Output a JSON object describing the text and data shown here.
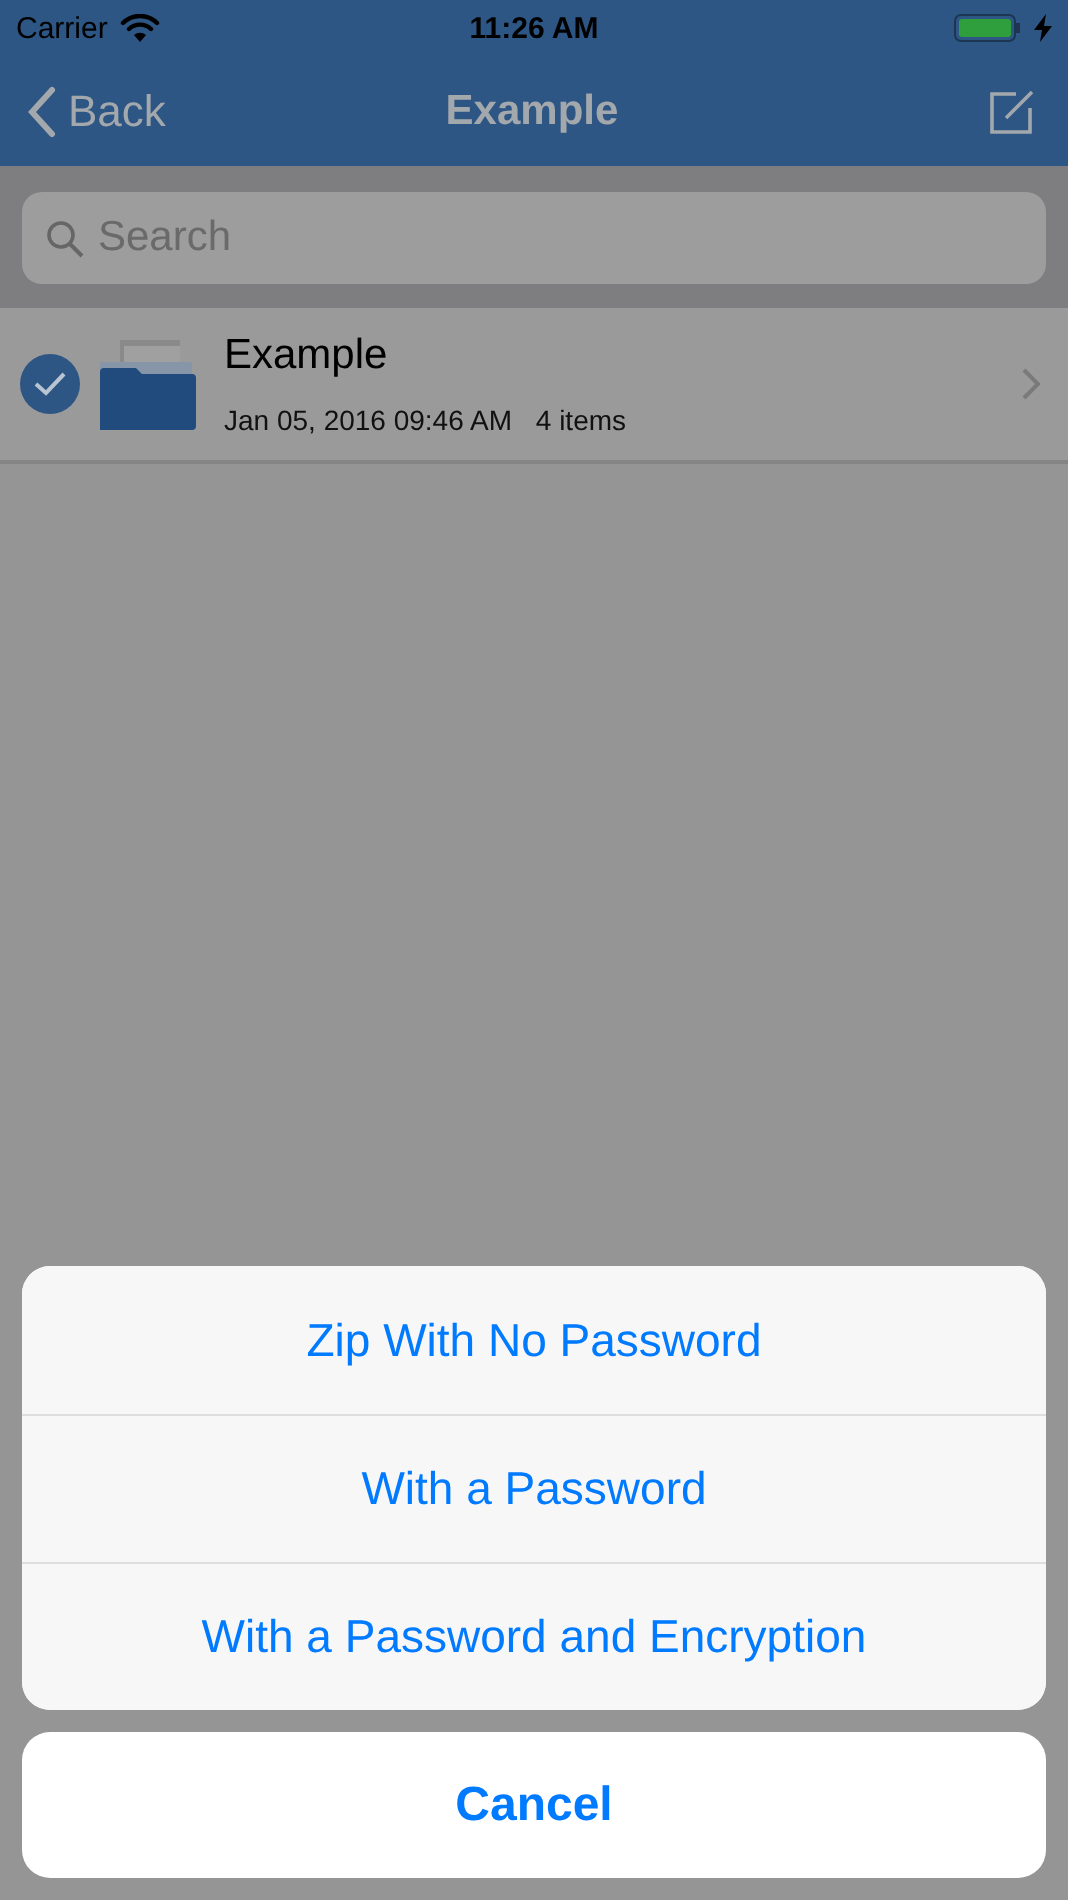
{
  "status_bar": {
    "carrier": "Carrier",
    "time": "11:26 AM",
    "charging": true
  },
  "nav_bar": {
    "back": "Back",
    "title": "Example"
  },
  "search": {
    "placeholder": "Search"
  },
  "files": [
    {
      "name": "Example",
      "date": "Jan 05, 2016 09:46 AM",
      "count": "4 items",
      "selected": true
    }
  ],
  "action_sheet": {
    "options": [
      "Zip With No Password",
      "With a Password",
      "With a Password and Encryption"
    ],
    "cancel": "Cancel"
  }
}
